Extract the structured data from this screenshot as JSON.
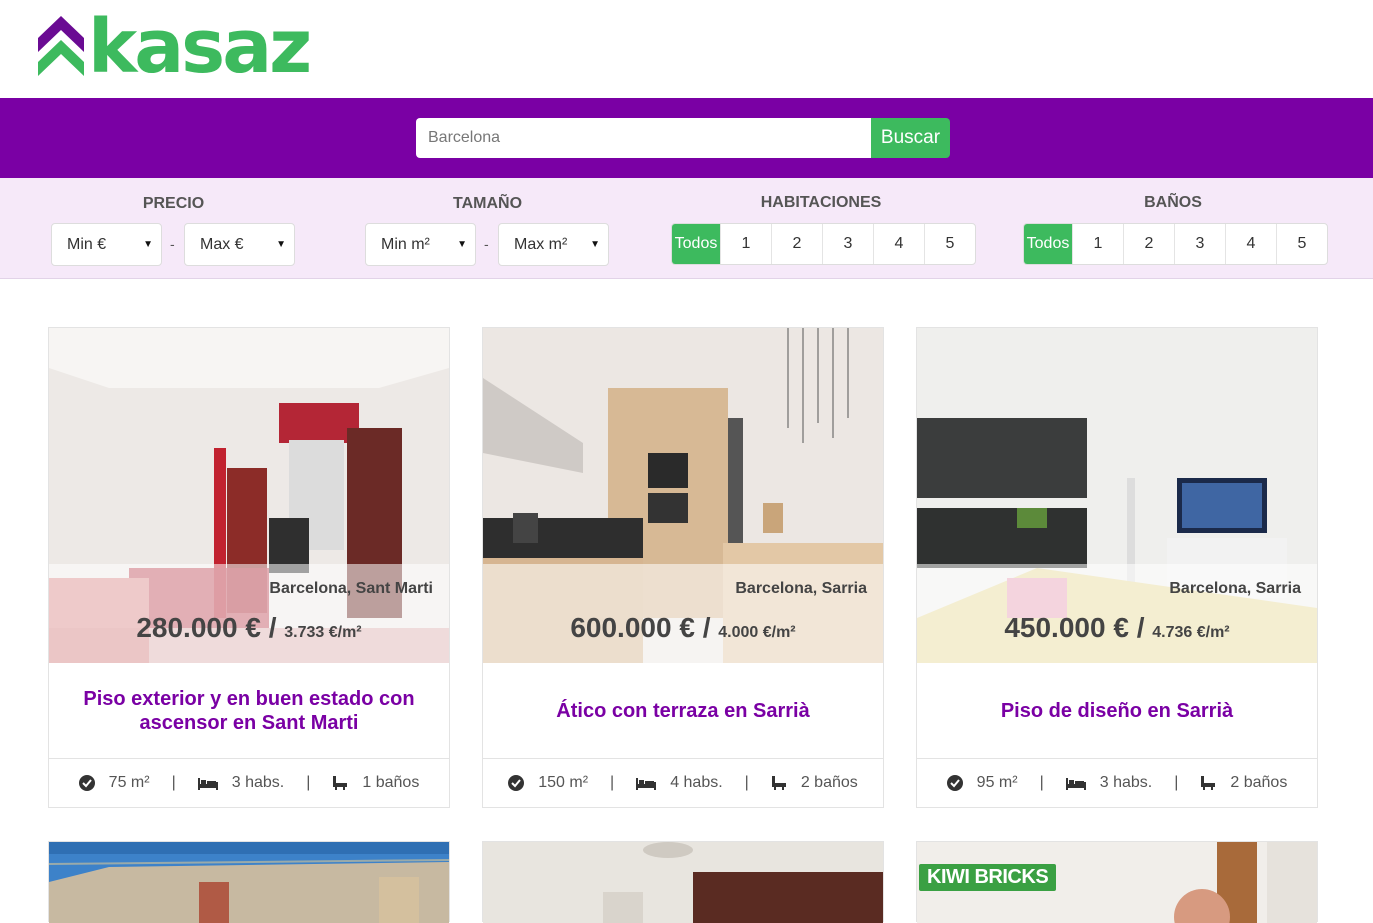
{
  "brand": {
    "name": "kasaz",
    "purple": "#7a00a4",
    "green": "#3dba5e"
  },
  "search": {
    "placeholder": "Barcelona",
    "button_label": "Buscar"
  },
  "filters": {
    "price": {
      "label": "PRECIO",
      "min": "Min €",
      "max": "Max €"
    },
    "size": {
      "label": "TAMAÑO",
      "min": "Min m²",
      "max": "Max m²"
    },
    "rooms": {
      "label": "HABITACIONES",
      "options": [
        "Todos",
        "1",
        "2",
        "3",
        "4",
        "5"
      ],
      "selected": "Todos"
    },
    "baths": {
      "label": "BAÑOS",
      "options": [
        "Todos",
        "1",
        "2",
        "3",
        "4",
        "5"
      ],
      "selected": "Todos"
    }
  },
  "listings": [
    {
      "location": "Barcelona, Sant Marti",
      "price": "280.000 € /",
      "price_sqm": "3.733 €/m²",
      "title": "Piso exterior y en buen estado con ascensor en Sant Marti",
      "size": "75 m²",
      "rooms": "3 habs.",
      "baths": "1 baños"
    },
    {
      "location": "Barcelona, Sarria",
      "price": "600.000 € /",
      "price_sqm": "4.000 €/m²",
      "title": "Ático con terraza en Sarrià",
      "size": "150 m²",
      "rooms": "4 habs.",
      "baths": "2 baños"
    },
    {
      "location": "Barcelona, Sarria",
      "price": "450.000 € /",
      "price_sqm": "4.736 €/m²",
      "title": "Piso de diseño en Sarrià",
      "size": "95 m²",
      "rooms": "3 habs.",
      "baths": "2 baños"
    }
  ],
  "partial_listings": [
    {
      "badge": ""
    },
    {
      "badge": ""
    },
    {
      "badge": "KIWI BRICKS"
    }
  ],
  "separator": "|"
}
